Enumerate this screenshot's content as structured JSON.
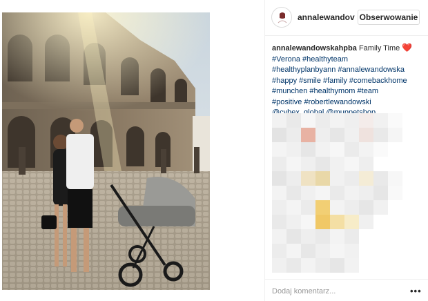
{
  "post": {
    "username": "annalewandov",
    "follow_label": "Obserwowanie",
    "caption": {
      "author": "annalewandowskahpba",
      "text": "Family Time",
      "heart": "❤️",
      "hashtag_lines": [
        "#Verona #healthyteam",
        "#healthyplanbyann #annalewandowska",
        "#happy #smile #family #comebackhome",
        "#munchen #healthymom #team",
        "#positive #robertlewandowski",
        "@cybex_global @muppetshop"
      ]
    },
    "comment_placeholder": "Dodaj komentarz...",
    "more_label": "•••",
    "icons": {
      "avatar": "profile-avatar-icon",
      "more": "more-options-icon"
    },
    "colors": {
      "link": "#003569",
      "heart": "#e0245e",
      "border": "#dbdbdb"
    }
  }
}
